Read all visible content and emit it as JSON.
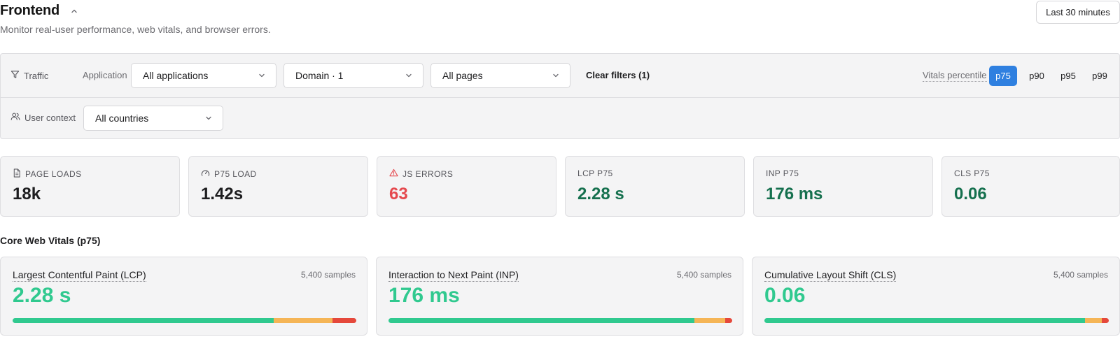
{
  "header": {
    "title": "Frontend",
    "subtitle": "Monitor real-user performance, web vitals, and browser errors.",
    "time_range": "Last 30 minutes"
  },
  "filters": {
    "traffic_label": "Traffic",
    "application_label": "Application",
    "application_value": "All applications",
    "domain_value": "Domain · 1",
    "pages_value": "All pages",
    "clear_label": "Clear filters (1)",
    "vitals_percentile_label": "Vitals percentile",
    "percentiles": [
      "p75",
      "p90",
      "p95",
      "p99"
    ],
    "active_percentile": "p75",
    "user_context_label": "User context",
    "country_value": "All countries"
  },
  "stats": [
    {
      "label": "PAGE LOADS",
      "value": "18k",
      "icon": "document-icon",
      "color": "#1d1d1f"
    },
    {
      "label": "P75 LOAD",
      "value": "1.42s",
      "icon": "gauge-icon",
      "color": "#1d1d1f"
    },
    {
      "label": "JS ERRORS",
      "value": "63",
      "icon": "warning-icon",
      "color": "#e5484d"
    },
    {
      "label": "LCP P75",
      "value": "2.28 s",
      "icon": "",
      "color": "#15704e"
    },
    {
      "label": "INP P75",
      "value": "176 ms",
      "icon": "",
      "color": "#15704e"
    },
    {
      "label": "CLS P75",
      "value": "0.06",
      "icon": "",
      "color": "#15704e"
    }
  ],
  "vitals_heading": "Core Web Vitals (p75)",
  "vitals": [
    {
      "title": "Largest Contentful Paint (LCP)",
      "samples": "5,400 samples",
      "value": "2.28 s",
      "distribution": {
        "good": 0.76,
        "needs_improvement": 0.17,
        "poor": 0.07
      }
    },
    {
      "title": "Interaction to Next Paint (INP)",
      "samples": "5,400 samples",
      "value": "176 ms",
      "distribution": {
        "good": 0.89,
        "needs_improvement": 0.09,
        "poor": 0.02
      }
    },
    {
      "title": "Cumulative Layout Shift (CLS)",
      "samples": "5,400 samples",
      "value": "0.06",
      "distribution": {
        "good": 0.93,
        "needs_improvement": 0.05,
        "poor": 0.02
      }
    }
  ],
  "colors": {
    "accent": "#2f80e0",
    "good": "#30c98f",
    "needs_improvement": "#f5b556",
    "poor": "#e5483b",
    "error": "#e5484d",
    "metric_green": "#15704e"
  }
}
